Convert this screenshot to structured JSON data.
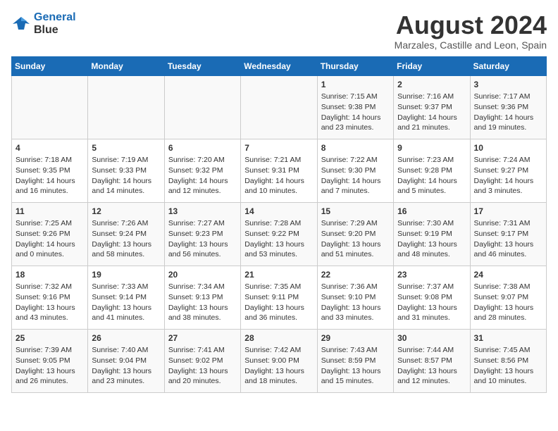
{
  "header": {
    "logo_line1": "General",
    "logo_line2": "Blue",
    "main_title": "August 2024",
    "subtitle": "Marzales, Castille and Leon, Spain"
  },
  "columns": [
    "Sunday",
    "Monday",
    "Tuesday",
    "Wednesday",
    "Thursday",
    "Friday",
    "Saturday"
  ],
  "weeks": [
    {
      "cells": [
        {
          "day": "",
          "info": ""
        },
        {
          "day": "",
          "info": ""
        },
        {
          "day": "",
          "info": ""
        },
        {
          "day": "",
          "info": ""
        },
        {
          "day": "1",
          "info": "Sunrise: 7:15 AM\nSunset: 9:38 PM\nDaylight: 14 hours\nand 23 minutes."
        },
        {
          "day": "2",
          "info": "Sunrise: 7:16 AM\nSunset: 9:37 PM\nDaylight: 14 hours\nand 21 minutes."
        },
        {
          "day": "3",
          "info": "Sunrise: 7:17 AM\nSunset: 9:36 PM\nDaylight: 14 hours\nand 19 minutes."
        }
      ]
    },
    {
      "cells": [
        {
          "day": "4",
          "info": "Sunrise: 7:18 AM\nSunset: 9:35 PM\nDaylight: 14 hours\nand 16 minutes."
        },
        {
          "day": "5",
          "info": "Sunrise: 7:19 AM\nSunset: 9:33 PM\nDaylight: 14 hours\nand 14 minutes."
        },
        {
          "day": "6",
          "info": "Sunrise: 7:20 AM\nSunset: 9:32 PM\nDaylight: 14 hours\nand 12 minutes."
        },
        {
          "day": "7",
          "info": "Sunrise: 7:21 AM\nSunset: 9:31 PM\nDaylight: 14 hours\nand 10 minutes."
        },
        {
          "day": "8",
          "info": "Sunrise: 7:22 AM\nSunset: 9:30 PM\nDaylight: 14 hours\nand 7 minutes."
        },
        {
          "day": "9",
          "info": "Sunrise: 7:23 AM\nSunset: 9:28 PM\nDaylight: 14 hours\nand 5 minutes."
        },
        {
          "day": "10",
          "info": "Sunrise: 7:24 AM\nSunset: 9:27 PM\nDaylight: 14 hours\nand 3 minutes."
        }
      ]
    },
    {
      "cells": [
        {
          "day": "11",
          "info": "Sunrise: 7:25 AM\nSunset: 9:26 PM\nDaylight: 14 hours\nand 0 minutes."
        },
        {
          "day": "12",
          "info": "Sunrise: 7:26 AM\nSunset: 9:24 PM\nDaylight: 13 hours\nand 58 minutes."
        },
        {
          "day": "13",
          "info": "Sunrise: 7:27 AM\nSunset: 9:23 PM\nDaylight: 13 hours\nand 56 minutes."
        },
        {
          "day": "14",
          "info": "Sunrise: 7:28 AM\nSunset: 9:22 PM\nDaylight: 13 hours\nand 53 minutes."
        },
        {
          "day": "15",
          "info": "Sunrise: 7:29 AM\nSunset: 9:20 PM\nDaylight: 13 hours\nand 51 minutes."
        },
        {
          "day": "16",
          "info": "Sunrise: 7:30 AM\nSunset: 9:19 PM\nDaylight: 13 hours\nand 48 minutes."
        },
        {
          "day": "17",
          "info": "Sunrise: 7:31 AM\nSunset: 9:17 PM\nDaylight: 13 hours\nand 46 minutes."
        }
      ]
    },
    {
      "cells": [
        {
          "day": "18",
          "info": "Sunrise: 7:32 AM\nSunset: 9:16 PM\nDaylight: 13 hours\nand 43 minutes."
        },
        {
          "day": "19",
          "info": "Sunrise: 7:33 AM\nSunset: 9:14 PM\nDaylight: 13 hours\nand 41 minutes."
        },
        {
          "day": "20",
          "info": "Sunrise: 7:34 AM\nSunset: 9:13 PM\nDaylight: 13 hours\nand 38 minutes."
        },
        {
          "day": "21",
          "info": "Sunrise: 7:35 AM\nSunset: 9:11 PM\nDaylight: 13 hours\nand 36 minutes."
        },
        {
          "day": "22",
          "info": "Sunrise: 7:36 AM\nSunset: 9:10 PM\nDaylight: 13 hours\nand 33 minutes."
        },
        {
          "day": "23",
          "info": "Sunrise: 7:37 AM\nSunset: 9:08 PM\nDaylight: 13 hours\nand 31 minutes."
        },
        {
          "day": "24",
          "info": "Sunrise: 7:38 AM\nSunset: 9:07 PM\nDaylight: 13 hours\nand 28 minutes."
        }
      ]
    },
    {
      "cells": [
        {
          "day": "25",
          "info": "Sunrise: 7:39 AM\nSunset: 9:05 PM\nDaylight: 13 hours\nand 26 minutes."
        },
        {
          "day": "26",
          "info": "Sunrise: 7:40 AM\nSunset: 9:04 PM\nDaylight: 13 hours\nand 23 minutes."
        },
        {
          "day": "27",
          "info": "Sunrise: 7:41 AM\nSunset: 9:02 PM\nDaylight: 13 hours\nand 20 minutes."
        },
        {
          "day": "28",
          "info": "Sunrise: 7:42 AM\nSunset: 9:00 PM\nDaylight: 13 hours\nand 18 minutes."
        },
        {
          "day": "29",
          "info": "Sunrise: 7:43 AM\nSunset: 8:59 PM\nDaylight: 13 hours\nand 15 minutes."
        },
        {
          "day": "30",
          "info": "Sunrise: 7:44 AM\nSunset: 8:57 PM\nDaylight: 13 hours\nand 12 minutes."
        },
        {
          "day": "31",
          "info": "Sunrise: 7:45 AM\nSunset: 8:56 PM\nDaylight: 13 hours\nand 10 minutes."
        }
      ]
    }
  ]
}
